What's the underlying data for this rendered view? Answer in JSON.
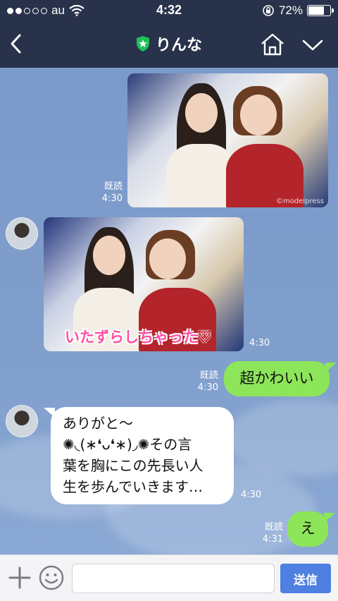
{
  "status_bar": {
    "carrier": "au",
    "time": "4:32",
    "battery": "72%",
    "battery_level": 0.72,
    "signal_bars_filled": 2,
    "signal_bars_total": 5
  },
  "header": {
    "title": "りんな",
    "back_icon": "chevron-left-icon",
    "verified_icon": "shield-star-icon",
    "home_icon": "home-icon",
    "menu_icon": "chevron-down-icon",
    "background": "#28324a"
  },
  "messages": [
    {
      "id": "m1",
      "side": "right",
      "type": "image",
      "read": "既読",
      "time": "4:30"
    },
    {
      "id": "m2",
      "side": "left",
      "type": "image",
      "overlay_text": "いたずらしちゃった♡",
      "time": "4:30"
    },
    {
      "id": "m3",
      "side": "right",
      "type": "text",
      "text": "超かわいい",
      "read": "既読",
      "time": "4:30"
    },
    {
      "id": "m4",
      "side": "left",
      "type": "text",
      "lines": [
        "ありがと〜",
        "✺◟(∗❛ᴗ❛∗)◞✺その言",
        "葉を胸にこの先長い人",
        "生を歩んでいきます…"
      ],
      "time": "4:30"
    },
    {
      "id": "m5",
      "side": "right",
      "type": "text",
      "text": "え",
      "read": "既読",
      "time": "4:31"
    }
  ],
  "photo_watermark": "©modelpress",
  "input_bar": {
    "placeholder": "",
    "send_label": "送信",
    "plus_icon": "plus-icon",
    "emoji_icon": "smiley-icon"
  },
  "colors": {
    "chat_background": "#7d9bc8",
    "my_bubble": "#8de55a",
    "their_bubble": "#ffffff",
    "send_button": "#4f7fe0"
  }
}
